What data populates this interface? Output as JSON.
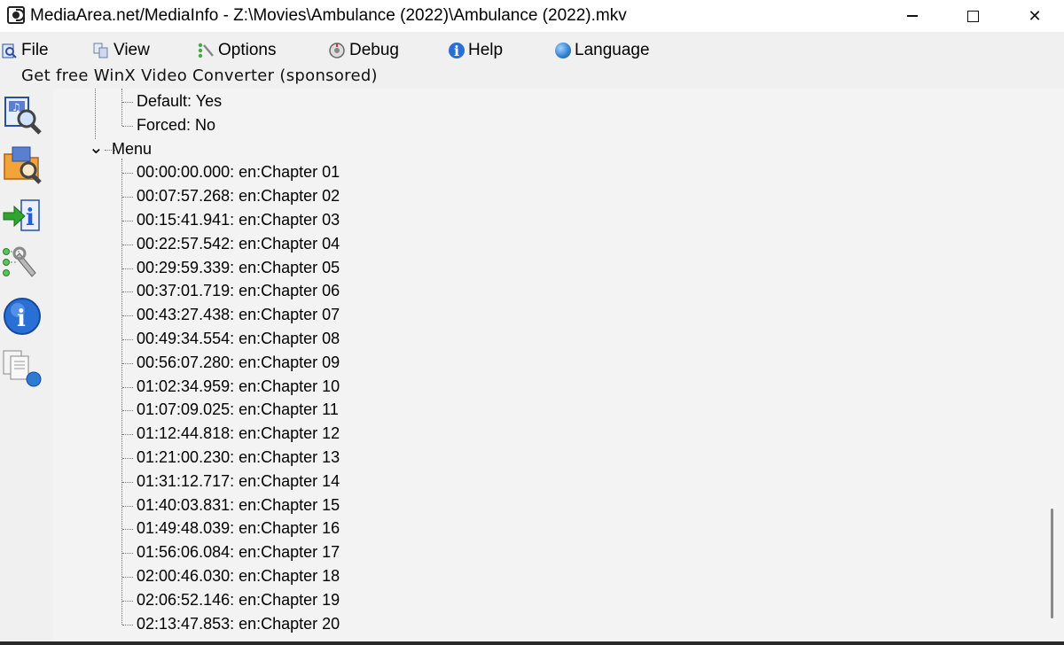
{
  "window": {
    "title": "MediaArea.net/MediaInfo - Z:\\Movies\\Ambulance (2022)\\Ambulance (2022).mkv",
    "controls": {
      "minimize": "—",
      "maximize": "□",
      "close": "✕"
    }
  },
  "menu": {
    "items": [
      {
        "label": "File",
        "icon": "file-icon"
      },
      {
        "label": "View",
        "icon": "view-icon"
      },
      {
        "label": "Options",
        "icon": "options-icon"
      },
      {
        "label": "Debug",
        "icon": "debug-icon"
      },
      {
        "label": "Help",
        "icon": "help-icon"
      },
      {
        "label": "Language",
        "icon": "language-icon"
      }
    ]
  },
  "sponsor": {
    "label": "Get free WinX Video Converter (sponsored)"
  },
  "toolbar": {
    "buttons": [
      {
        "name": "open-file",
        "icon": "open-file-icon"
      },
      {
        "name": "open-folder",
        "icon": "open-folder-icon"
      },
      {
        "name": "export",
        "icon": "export-icon"
      },
      {
        "name": "preferences",
        "icon": "preferences-icon"
      },
      {
        "name": "about",
        "icon": "about-icon"
      },
      {
        "name": "knowledge-base",
        "icon": "knowledge-icon"
      }
    ]
  },
  "tree": {
    "subtitle_props": [
      {
        "label": "Default: Yes"
      },
      {
        "label": "Forced: No"
      }
    ],
    "menu_node": {
      "label": "Menu",
      "expanded": true
    },
    "chapters": [
      "00:00:00.000: en:Chapter 01",
      "00:07:57.268: en:Chapter 02",
      "00:15:41.941: en:Chapter 03",
      "00:22:57.542: en:Chapter 04",
      "00:29:59.339: en:Chapter 05",
      "00:37:01.719: en:Chapter 06",
      "00:43:27.438: en:Chapter 07",
      "00:49:34.554: en:Chapter 08",
      "00:56:07.280: en:Chapter 09",
      "01:02:34.959: en:Chapter 10",
      "01:07:09.025: en:Chapter 11",
      "01:12:44.818: en:Chapter 12",
      "01:21:00.230: en:Chapter 13",
      "01:31:12.717: en:Chapter 14",
      "01:40:03.831: en:Chapter 15",
      "01:49:48.039: en:Chapter 16",
      "01:56:06.084: en:Chapter 17",
      "02:00:46.030: en:Chapter 18",
      "02:06:52.146: en:Chapter 19",
      "02:13:47.853: en:Chapter 20"
    ]
  }
}
